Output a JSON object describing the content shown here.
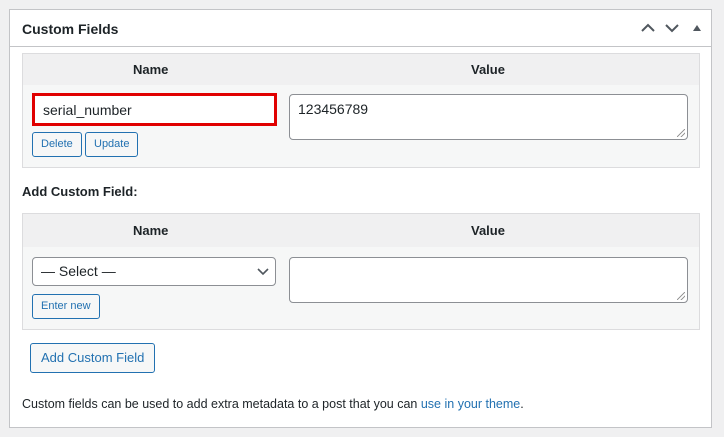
{
  "title": "Custom Fields",
  "existing": {
    "name_header": "Name",
    "value_header": "Value",
    "name_value": "serial_number",
    "value_value": "123456789",
    "delete_label": "Delete",
    "update_label": "Update"
  },
  "add": {
    "heading": "Add Custom Field:",
    "name_header": "Name",
    "value_header": "Value",
    "select_value": "— Select —",
    "value_value": "",
    "enter_new_label": "Enter new",
    "submit_label": "Add Custom Field"
  },
  "footer": {
    "text": "Custom fields can be used to add extra metadata to a post that you can ",
    "link": "use in your theme",
    "end": "."
  },
  "colors": {
    "highlight": "#e00000",
    "accent": "#2271b1"
  }
}
